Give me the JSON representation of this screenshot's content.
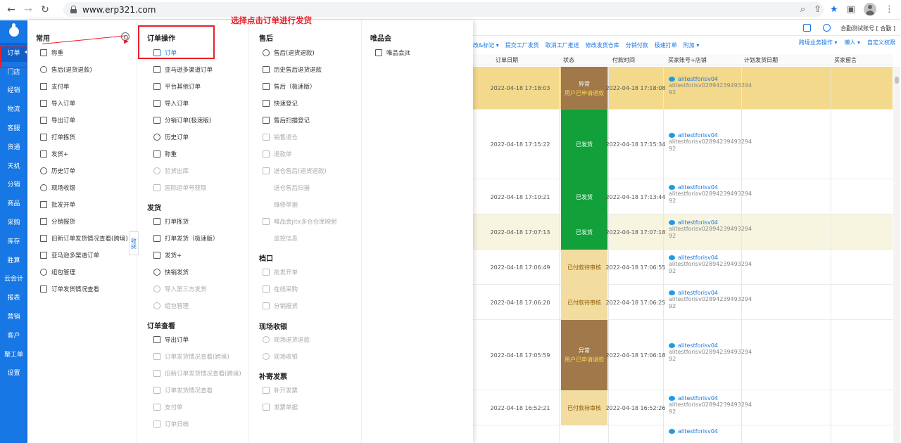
{
  "browser": {
    "url": "www.erp321.com"
  },
  "left_nav": {
    "items": [
      "订单",
      "门店",
      "经销",
      "物流",
      "客服",
      "货通",
      "天机",
      "分销",
      "商品",
      "采购",
      "库存",
      "胜算",
      "云会计",
      "报表",
      "营销",
      "客户",
      "聚工单",
      "设置"
    ],
    "active": "订单"
  },
  "annotation": "选择点击订单进行发货",
  "common": {
    "title": "常用",
    "items": [
      "称重",
      "售后(退货退款)",
      "支付单",
      "导入订单",
      "导出订单",
      "打单拣货",
      "发货+",
      "历史订单",
      "现场收银",
      "批发开单",
      "分销报货",
      "旧新订单发货情况查看(跨境)",
      "亚马逊多渠道订单",
      "组包管理",
      "订单发货情况查看"
    ],
    "collapse_label": "收拢"
  },
  "col2": {
    "sec1_title": "订单操作",
    "sec1_items": [
      "订单",
      "亚马逊多渠道订单",
      "平台其他订单",
      "导入订单",
      "分销订单(极速版)",
      "历史订单",
      "称重",
      "验货出库",
      "国际运单号获取"
    ],
    "sec2_title": "发货",
    "sec2_items": [
      "打单拣货",
      "打单发货（极速版）",
      "发货+",
      "快销发货",
      "导入第三方发货",
      "组包管理"
    ],
    "sec3_title": "订单查看",
    "sec3_items": [
      "导出订单",
      "订单发货情况查看(跨境)",
      "旧新订单发货情况查看(跨境)",
      "订单发货情况查看",
      "支付单",
      "订单归档"
    ]
  },
  "col3": {
    "sec1_title": "售后",
    "sec1_items": [
      "售后(退货退款)",
      "历史售后退货退款",
      "售后（极速版）",
      "快速登记",
      "售后扫描登记",
      "销售退仓",
      "退款单",
      "送仓售后(退货退款)",
      "送仓售后扫描",
      "维修单据",
      "唯品会jitx多仓仓库映射",
      "监控信息"
    ],
    "sec2_title": "档口",
    "sec2_items": [
      "批发开单",
      "在线采购",
      "分销报货"
    ],
    "sec3_title": "现场收银",
    "sec3_items": [
      "现场退货退款",
      "现场收银"
    ],
    "sec4_title": "补寄发票",
    "sec4_items": [
      "补开发票",
      "发票单据"
    ]
  },
  "col4": {
    "title": "唯品会",
    "items": [
      "唯品会jit"
    ]
  },
  "bg": {
    "account": "合勤测试账号 [ 合勤 ]",
    "toolbar": [
      "改&标记 ▾",
      "提交工厂发货",
      "取消工厂推送",
      "修改发货仓库",
      "分销付款",
      "极速打单",
      "附加 ▾"
    ],
    "toolbar_right": [
      "跨境业务操作 ▾",
      "懒人 ▾",
      "自定义权限"
    ],
    "headers": [
      "订单日期",
      "状态",
      "付款时间",
      "买家账号+店铺",
      "计划发货日期",
      "买家留言"
    ],
    "rows": [
      {
        "date": "2022-04-18 17:18:03",
        "status": "异常",
        "status2": "用户已申请退款",
        "pay": "2022-04-18 17:18:08",
        "buyer": "alitestforisv04",
        "sub1": "alitestforisv02894239493294",
        "sub2": "92"
      },
      {
        "date": "2022-04-18 17:15:22",
        "status": "已发货",
        "status2": "",
        "pay": "2022-04-18 17:15:34",
        "buyer": "alitestforisv04",
        "sub1": "alitestforisv02894239493294",
        "sub2": "92"
      },
      {
        "date": "2022-04-18 17:10:21",
        "status": "已发货",
        "status2": "",
        "pay": "2022-04-18 17:13:44",
        "buyer": "alitestforisv04",
        "sub1": "alitestforisv02894239493294",
        "sub2": "92"
      },
      {
        "date": "2022-04-18 17:07:13",
        "status": "已发货",
        "status2": "",
        "pay": "2022-04-18 17:07:18",
        "buyer": "alitestforisv04",
        "sub1": "alitestforisv02894239493294",
        "sub2": "92"
      },
      {
        "date": "2022-04-18 17:06:49",
        "status": "已付款待审核",
        "status2": "",
        "pay": "2022-04-18 17:06:55",
        "buyer": "alitestforisv04",
        "sub1": "alitestforisv02894239493294",
        "sub2": "92"
      },
      {
        "date": "2022-04-18 17:06:20",
        "status": "已付款待审核",
        "status2": "",
        "pay": "2022-04-18 17:06:25",
        "buyer": "alitestforisv04",
        "sub1": "alitestforisv02894239493294",
        "sub2": "92"
      },
      {
        "date": "2022-04-18 17:05:59",
        "status": "异常",
        "status2": "用户已申请退款",
        "pay": "2022-04-18 17:06:18",
        "buyer": "alitestforisv04",
        "sub1": "alitestforisv02894239493294",
        "sub2": "92"
      },
      {
        "date": "2022-04-18 16:52:21",
        "status": "已付款待审核",
        "status2": "",
        "pay": "2022-04-18 16:52:26",
        "buyer": "alitestforisv04",
        "sub1": "alitestforisv02894239493294",
        "sub2": "92"
      },
      {
        "date": "",
        "status": "",
        "status2": "",
        "pay": "",
        "buyer": "alitestforisv04",
        "sub1": "",
        "sub2": ""
      }
    ]
  },
  "colors": {
    "primary": "#1677e5",
    "red": "#e8202a",
    "abnormal": "#a0784a",
    "shipped": "#12a03a",
    "pending": "#f3dca0",
    "row_highlight": "#f3d98c"
  }
}
